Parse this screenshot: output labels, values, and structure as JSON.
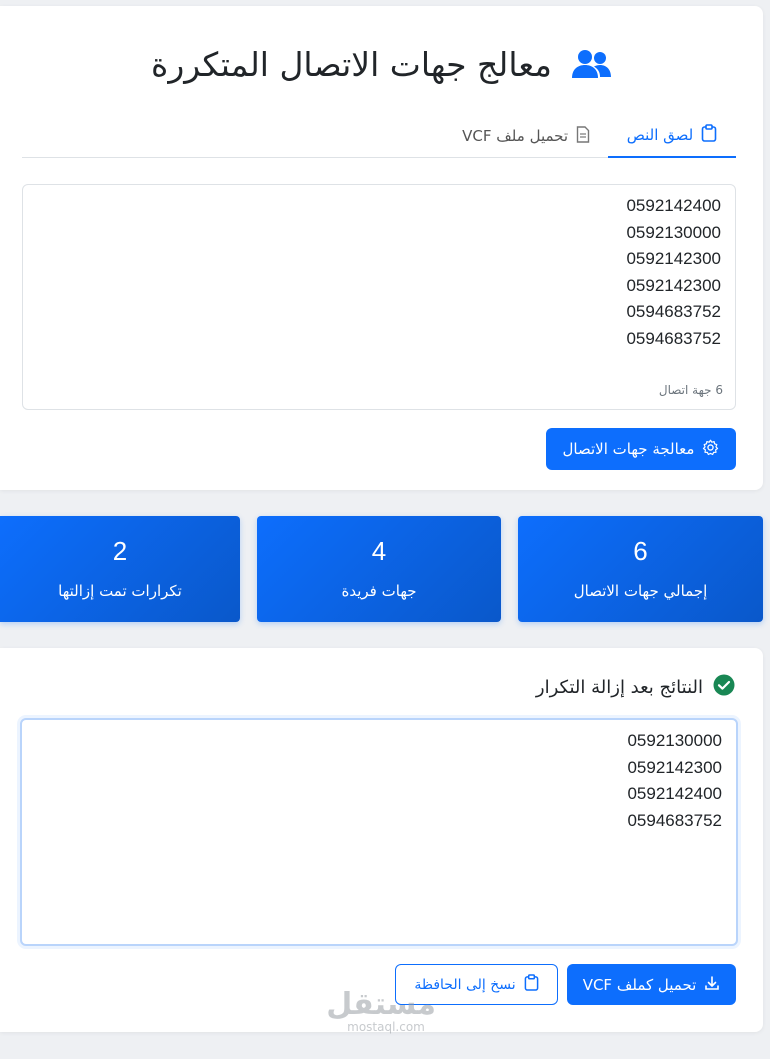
{
  "app": {
    "title": "معالج جهات الاتصال المتكررة"
  },
  "tabs": [
    {
      "label": "لصق النص",
      "active": true
    },
    {
      "label": "تحميل ملف VCF",
      "active": false
    }
  ],
  "input": {
    "numbers": [
      "0592142400",
      "0592130000",
      "0592142300",
      "0592142300",
      "0594683752",
      "0594683752"
    ],
    "count_hint": "6 جهة اتصال"
  },
  "process_button": {
    "label": "معالجة جهات الاتصال"
  },
  "stats": {
    "total": {
      "value": "6",
      "label": "إجمالي جهات الاتصال"
    },
    "unique": {
      "value": "4",
      "label": "جهات فريدة"
    },
    "duplicates": {
      "value": "2",
      "label": "تكرارات تمت إزالتها"
    }
  },
  "results": {
    "title": "النتائج بعد إزالة التكرار",
    "numbers": [
      "0592130000",
      "0592142300",
      "0592142400",
      "0594683752"
    ]
  },
  "download_button": {
    "label": "تحميل كملف VCF"
  },
  "copy_button": {
    "label": "نسخ إلى الحافظة"
  },
  "watermark": {
    "arabic": "مستقل",
    "latin": "mostaql.com"
  },
  "colors": {
    "primary": "#0d6efd",
    "success": "#198754",
    "background": "#eef0f3"
  }
}
